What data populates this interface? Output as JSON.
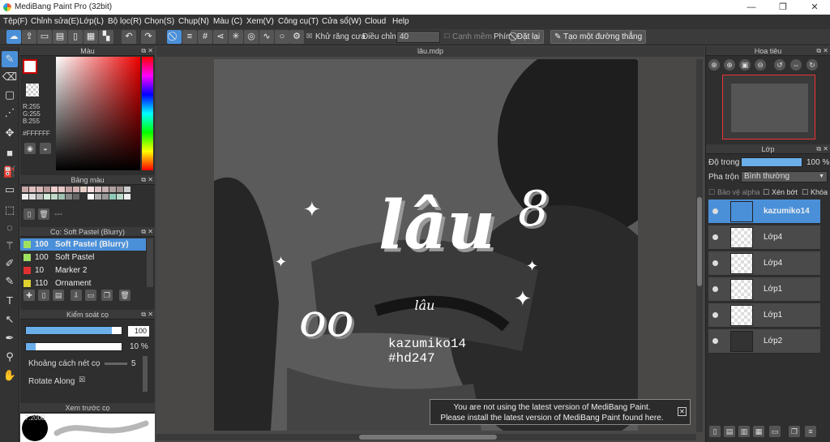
{
  "app": {
    "title": "MediBang Paint Pro (32bit)"
  },
  "menu": [
    "Tệp(F)",
    "Chỉnh sửa(E)",
    "Lớp(L)",
    "Bộ lọc(R)",
    "Chọn(S)",
    "Chụp(N)",
    "Màu (C)",
    "Xem(V)",
    "Công cụ(T)",
    "Cửa sổ(W)",
    "Cloud",
    "Help"
  ],
  "toolbar": {
    "antialias_label": "Khử răng cưa",
    "correction_label": "Điều chỉnh",
    "correction_value": "40",
    "smooth_label": "Cạnh mềm",
    "key_label": "Phím",
    "reset_label": "Đặt lại",
    "create_line_label": "Tạo một đường thẳng"
  },
  "color_panel": {
    "title": "Màu",
    "r": "R:255",
    "g": "G:255",
    "b": "B:255",
    "hex": "#FFFFFF"
  },
  "palette_panel": {
    "title": "Bảng màu",
    "placeholder": "---"
  },
  "brush_panel": {
    "title": "Cọ: Soft Pastel (Blurry)",
    "items": [
      {
        "size": "100",
        "name": "Soft Pastel (Blurry)",
        "color": "#a0e060"
      },
      {
        "size": "100",
        "name": "Soft Pastel",
        "color": "#a0e060"
      },
      {
        "size": "10",
        "name": "Marker 2",
        "color": "#e03030"
      },
      {
        "size": "110",
        "name": "Ornament",
        "color": "#e0d030"
      }
    ]
  },
  "brush_control": {
    "title": "Kiểm soát cọ",
    "size_value": "100",
    "size_fraction": 0.9,
    "opacity_value": "10 %",
    "opacity_fraction": 0.1,
    "spacing_label": "Khoảng cách nét cọ",
    "spacing_value": "5",
    "rotate_label": "Rotate Along"
  },
  "preview_panel": {
    "title": "Xem trước cọ",
    "size_label": "7.2000"
  },
  "document": {
    "tab": "lâu.mdp",
    "art_title": "lâu",
    "art_subtitle": "lâu",
    "credit_line1": "kazumiko14",
    "credit_line2": "#hd247"
  },
  "notification": {
    "line1": "You are not using the latest version of MediBang Paint.",
    "line2": "Please install the latest version of MediBang Paint found here."
  },
  "navigator": {
    "title": "Hoa tiêu"
  },
  "layers_panel": {
    "title": "Lớp",
    "opacity_label": "Độ trong",
    "opacity_value": "100 %",
    "opacity_fraction": 1.0,
    "blend_label": "Pha trộn",
    "blend_value": "Bình thường",
    "alpha_protect": "Bảo vệ alpha",
    "clipping": "Xén bớt",
    "lock": "Khóa",
    "layers": [
      {
        "name": "kazumiko14",
        "selected": true
      },
      {
        "name": "Lớp4",
        "selected": false
      },
      {
        "name": "Lớp4",
        "selected": false
      },
      {
        "name": "Lớp1",
        "selected": false
      },
      {
        "name": "Lớp1",
        "selected": false
      },
      {
        "name": "Lớp2",
        "selected": false
      }
    ]
  }
}
